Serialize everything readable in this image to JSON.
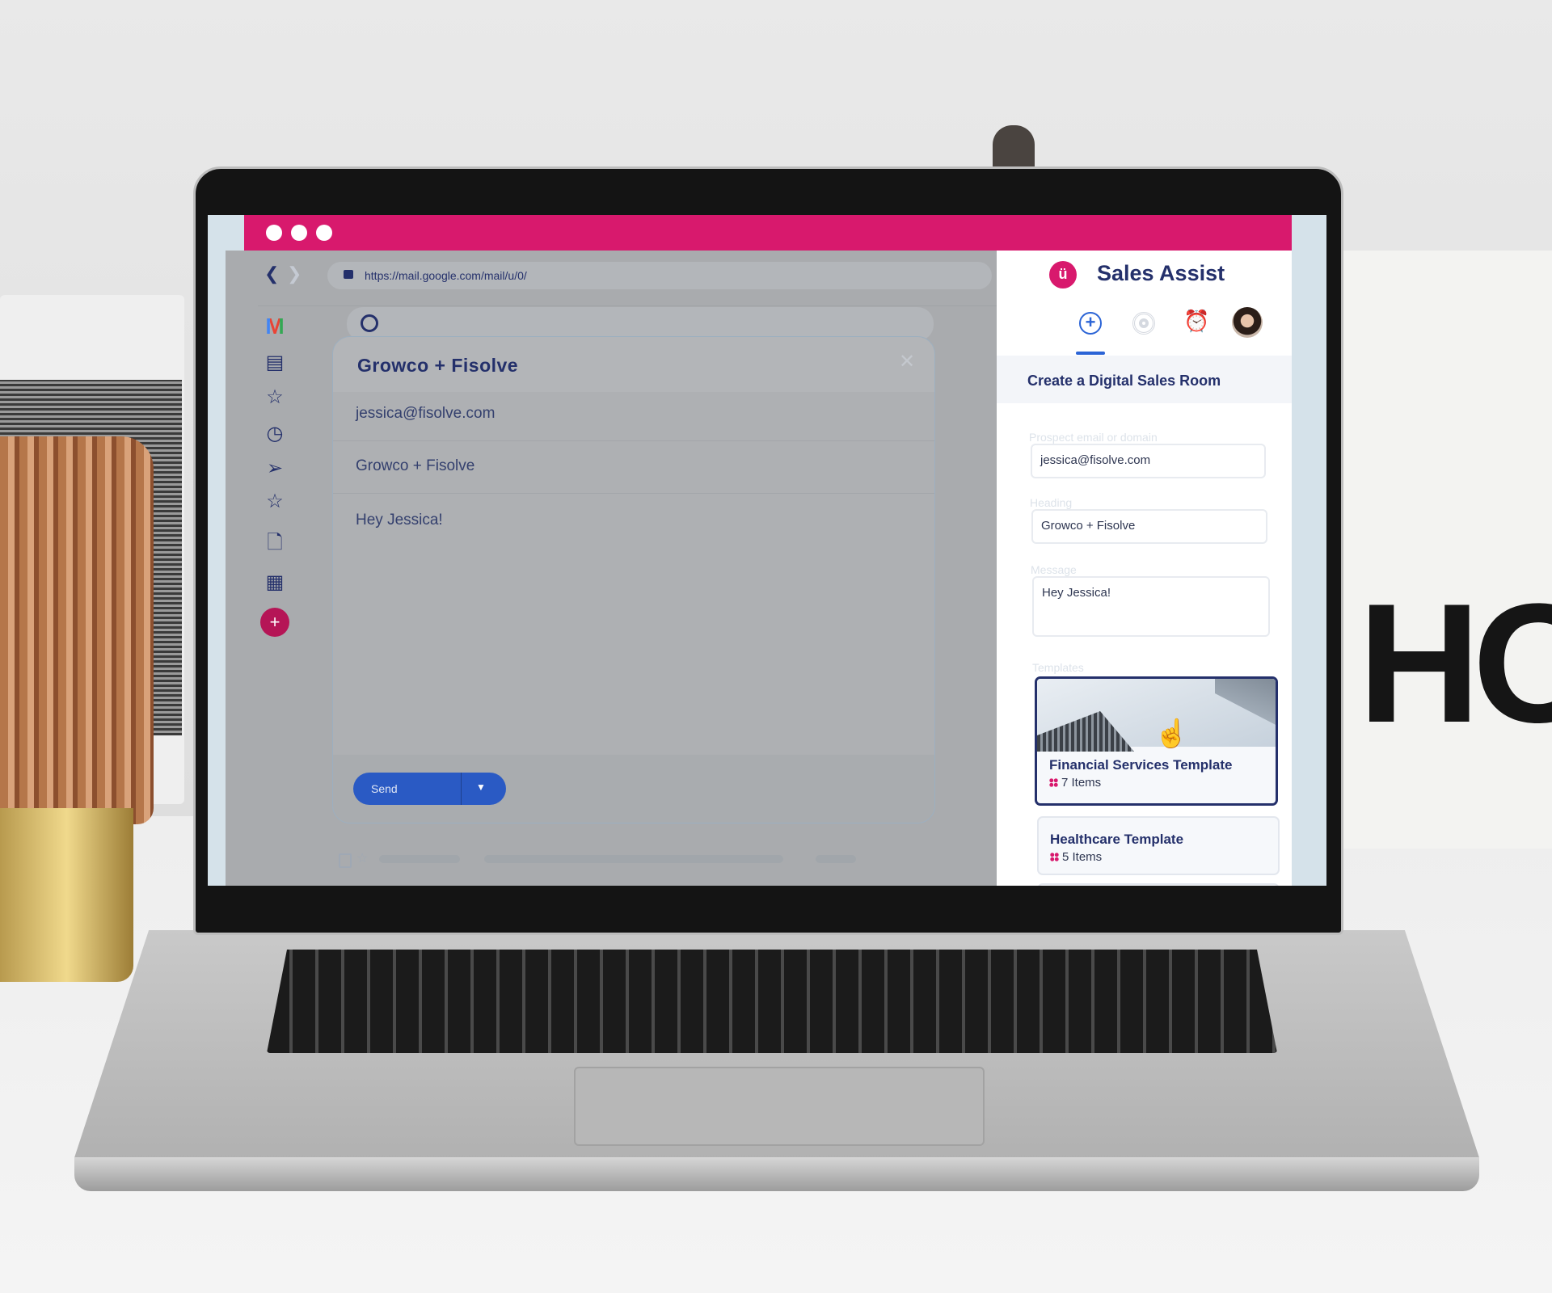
{
  "browser": {
    "url": "https://mail.google.com/mail/u/0/",
    "back_icon": "chevron-left-icon",
    "forward_icon": "chevron-right-icon",
    "lock_icon": "lock-icon",
    "accent": "#d8196d"
  },
  "gmail": {
    "sidebar_icons": [
      "gmail-logo",
      "inbox-icon",
      "star-icon",
      "clock-icon",
      "label-icon",
      "star-icon",
      "draft-icon",
      "trash-icon",
      "compose-plus-icon"
    ],
    "compose": {
      "title": "Growco + Fisolve",
      "to": "jessica@fisolve.com",
      "subject": "Growco + Fisolve",
      "body": "Hey Jessica!",
      "send_label": "Send",
      "send_color": "#2a5ac4"
    }
  },
  "panel": {
    "title": "Sales Assist",
    "tabs": [
      "add-icon",
      "target-icon",
      "alarm-icon",
      "avatar"
    ],
    "active_tab": 0,
    "section_title": "Create a Digital Sales Room",
    "fields": {
      "prospect_label": "Prospect email or domain",
      "prospect_value": "jessica@fisolve.com",
      "heading_label": "Heading",
      "heading_value": "Growco + Fisolve",
      "message_label": "Message",
      "message_value": "Hey Jessica!"
    },
    "templates_label": "Templates",
    "templates": [
      {
        "name": "Financial Services Template",
        "items": "7 Items",
        "selected": true
      },
      {
        "name": "Healthcare Template",
        "items": "5 Items",
        "selected": false
      }
    ]
  },
  "background": {
    "box_text": "HO"
  }
}
